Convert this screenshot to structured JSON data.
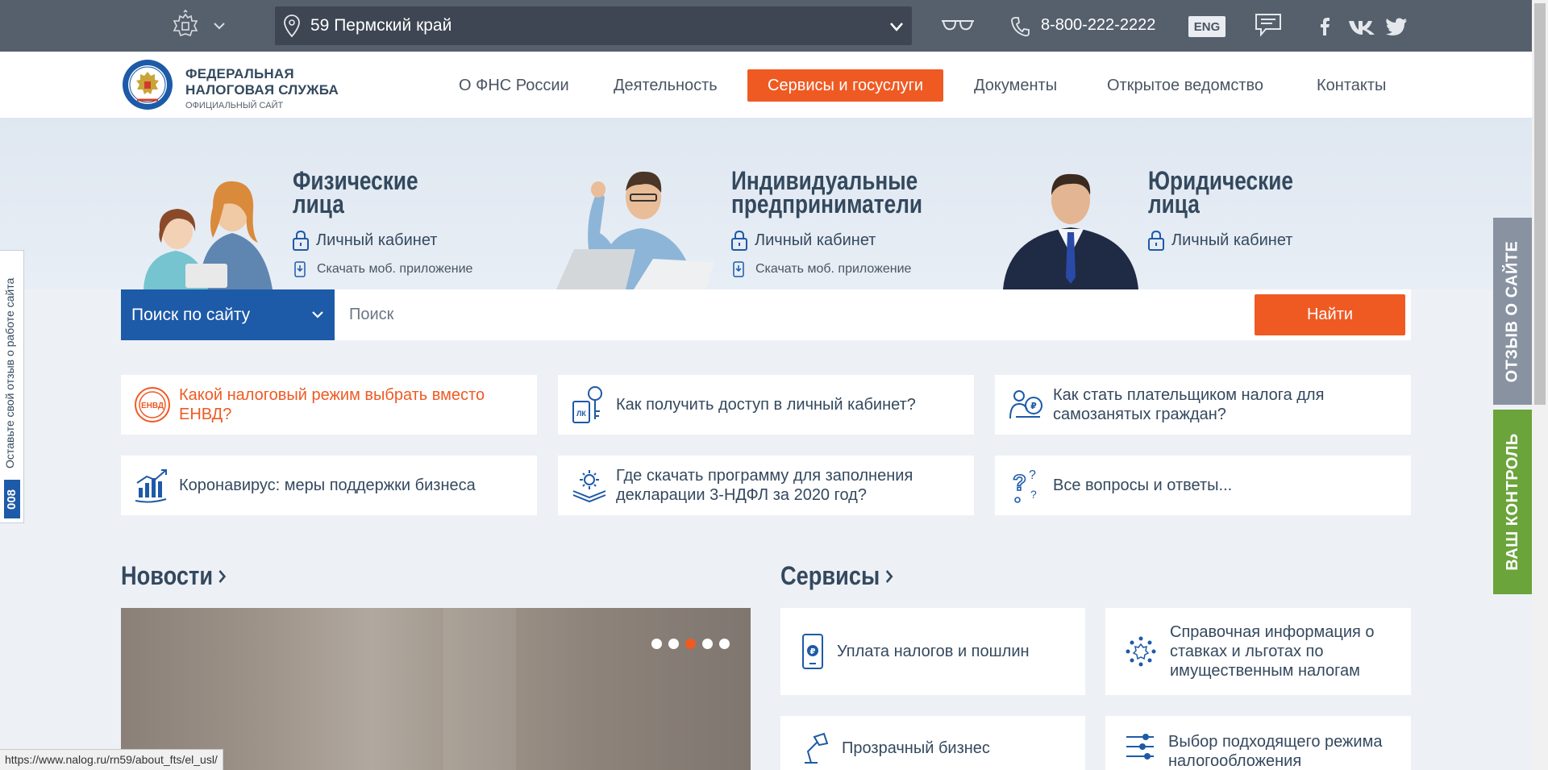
{
  "topbar": {
    "region": "59 Пермский край",
    "phone": "8-800-222-2222",
    "lang": "ENG"
  },
  "header": {
    "logo_line1": "ФЕДЕРАЛЬНАЯ",
    "logo_line2": "НАЛОГОВАЯ СЛУЖБА",
    "logo_line3": "ОФИЦИАЛЬНЫЙ САЙТ",
    "nav": [
      "О ФНС России",
      "Деятельность",
      "Сервисы и госуслуги",
      "Документы",
      "Открытое ведомство",
      "Контакты"
    ]
  },
  "categories": [
    {
      "title1": "Физические",
      "title2": "лица",
      "link": "Личный кабинет",
      "sub": "Скачать моб. приложение"
    },
    {
      "title1": "Индивидуальные",
      "title2": "предприниматели",
      "link": "Личный кабинет",
      "sub": "Скачать моб. приложение"
    },
    {
      "title1": "Юридические",
      "title2": "лица",
      "link": "Личный кабинет"
    }
  ],
  "search": {
    "scope": "Поиск по сайту",
    "placeholder": "Поиск",
    "button": "Найти"
  },
  "quick": [
    {
      "text": "Какой налоговый режим выбрать вместо ЕНВД?",
      "icon": "envd-icon",
      "badge": "ЕНВД"
    },
    {
      "text": "Как получить доступ в личный кабинет?",
      "icon": "key-lk-icon",
      "badge": "ЛК"
    },
    {
      "text": "Как стать плательщиком налога для самозанятых граждан?",
      "icon": "self-employed-icon"
    },
    {
      "text": "Коронавирус: меры поддержки бизнеса",
      "icon": "growth-chart-icon"
    },
    {
      "text": "Где скачать программу для заполнения декларации 3-НДФЛ за 2020 год?",
      "icon": "gear-icon"
    },
    {
      "text": "Все вопросы и ответы...",
      "icon": "questions-icon"
    }
  ],
  "news": {
    "title": "Новости"
  },
  "services": {
    "title": "Сервисы",
    "items": [
      "Уплата налогов и пошлин",
      "Справочная информация о ставках и льготах по имущественным налогам",
      "Прозрачный бизнес",
      "Выбор подходящего режима налогообложения"
    ]
  },
  "side": {
    "feedback_text": "Оставьте свой отзыв о работе сайта",
    "feedback_badge": "008",
    "review_tab": "ОТЗЫВ О САЙТЕ",
    "control_tab": "ВАШ КОНТРОЛЬ"
  },
  "status_url": "https://www.nalog.ru/rn59/about_fts/el_usl/",
  "colors": {
    "accent": "#ef5a23",
    "primary": "#1d5aa8",
    "topbar": "#56606d",
    "green": "#6aa43a"
  }
}
